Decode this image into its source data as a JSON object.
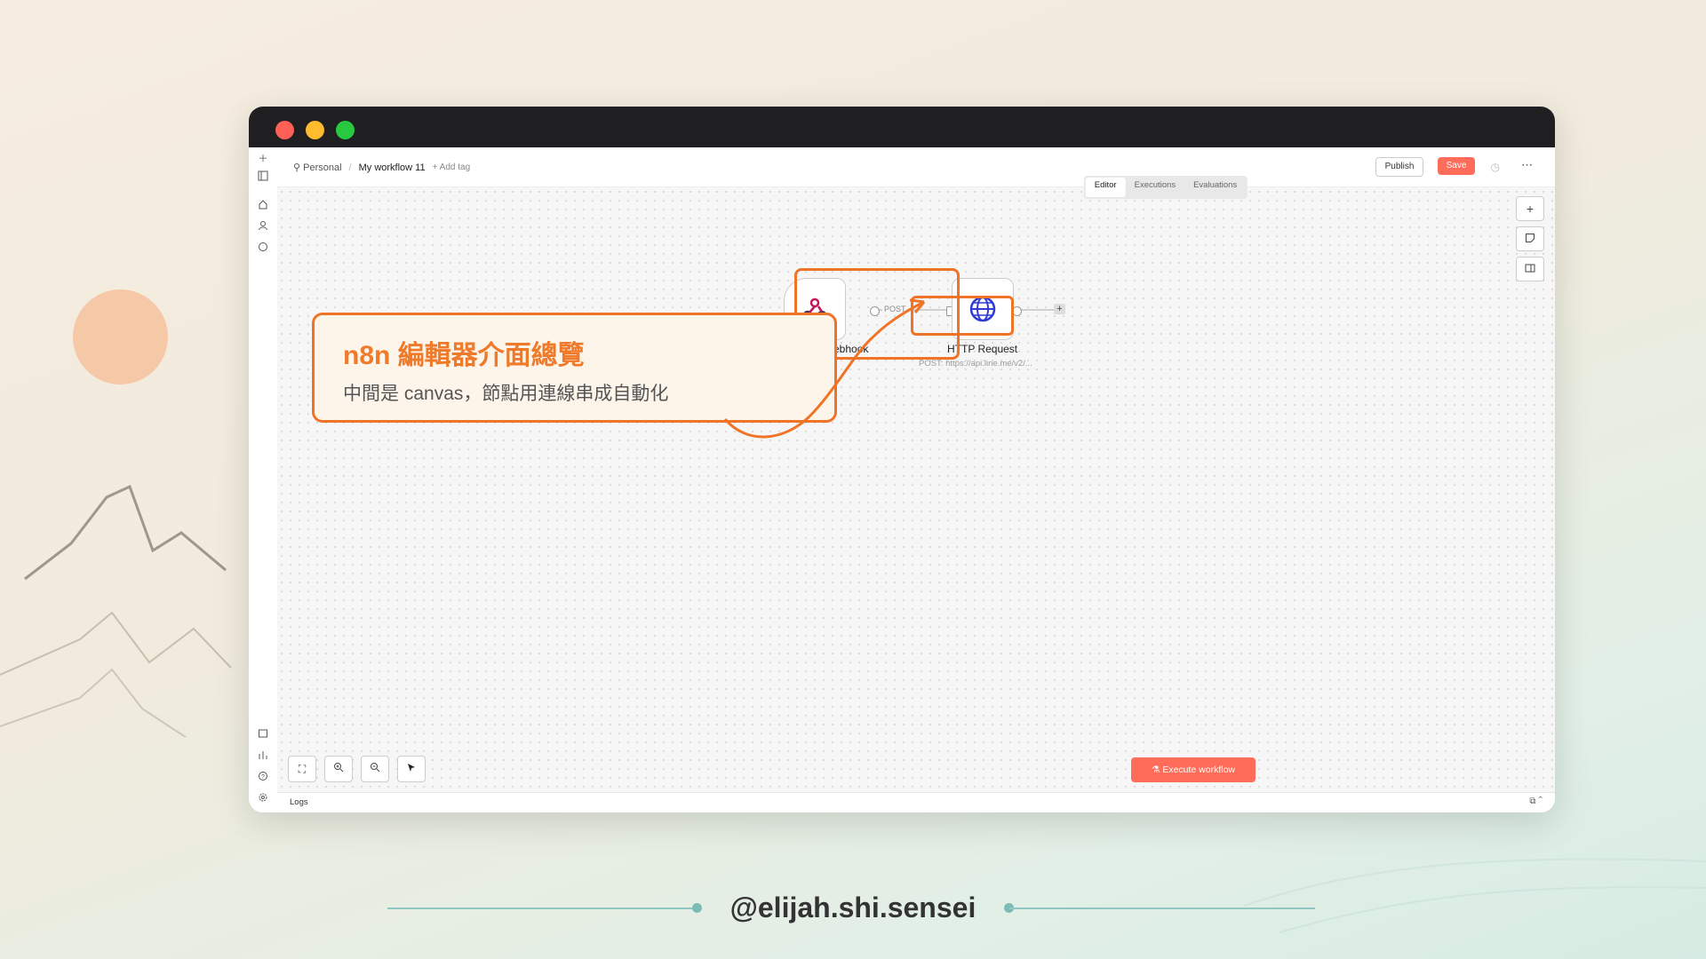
{
  "breadcrumb": {
    "project": "Personal",
    "separator": "/",
    "workflow": "My workflow 11",
    "add_tag": "+ Add tag"
  },
  "toolbar": {
    "publish_label": "Publish",
    "save_label": "Save"
  },
  "tabs": [
    "Editor",
    "Executions",
    "Evaluations"
  ],
  "active_tab": "Editor",
  "nodes": {
    "webhook": {
      "label": "Webhook",
      "visible_label": "ebhook",
      "icon": "webhook-icon"
    },
    "edge_label": "POST",
    "http": {
      "label": "HTTP Request",
      "subtitle": "POST: https://api.line.me/v2/..."
    }
  },
  "canvas_buttons": {
    "execute_label": "Execute workflow"
  },
  "logs": {
    "label": "Logs"
  },
  "callout": {
    "title": "n8n 編輯器介面總覽",
    "subtitle": "中間是 canvas，節點用連線串成自動化"
  },
  "footer": {
    "handle": "@elijah.shi.sensei"
  },
  "colors": {
    "accent": "#ff6d5a",
    "callout_orange": "#f07427",
    "callout_bg": "#fdf5ea"
  }
}
